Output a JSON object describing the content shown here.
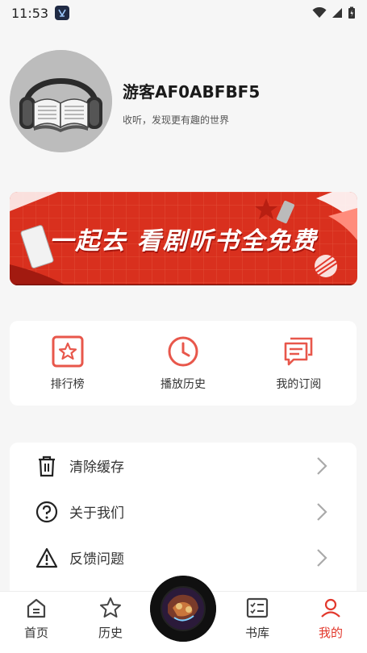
{
  "status": {
    "time": "11:53"
  },
  "profile": {
    "username": "游客AF0ABFBF5",
    "tagline": "收听，发现更有趣的世界"
  },
  "banner": {
    "text": "一起去 看剧听书全免费"
  },
  "quick_links": [
    {
      "label": "排行榜",
      "icon": "star-icon"
    },
    {
      "label": "播放历史",
      "icon": "clock-icon"
    },
    {
      "label": "我的订阅",
      "icon": "message-icon"
    }
  ],
  "menu": [
    {
      "label": "清除缓存",
      "icon": "trash-icon"
    },
    {
      "label": "关于我们",
      "icon": "question-icon"
    },
    {
      "label": "反馈问题",
      "icon": "warning-icon"
    }
  ],
  "tabs": [
    {
      "label": "首页",
      "icon": "home-icon"
    },
    {
      "label": "历史",
      "icon": "star-icon"
    },
    {
      "label": "书库",
      "icon": "checklist-icon"
    },
    {
      "label": "我的",
      "icon": "user-icon",
      "active": true
    }
  ],
  "colors": {
    "accent": "#e2382c",
    "banner_red": "#d9301e"
  }
}
